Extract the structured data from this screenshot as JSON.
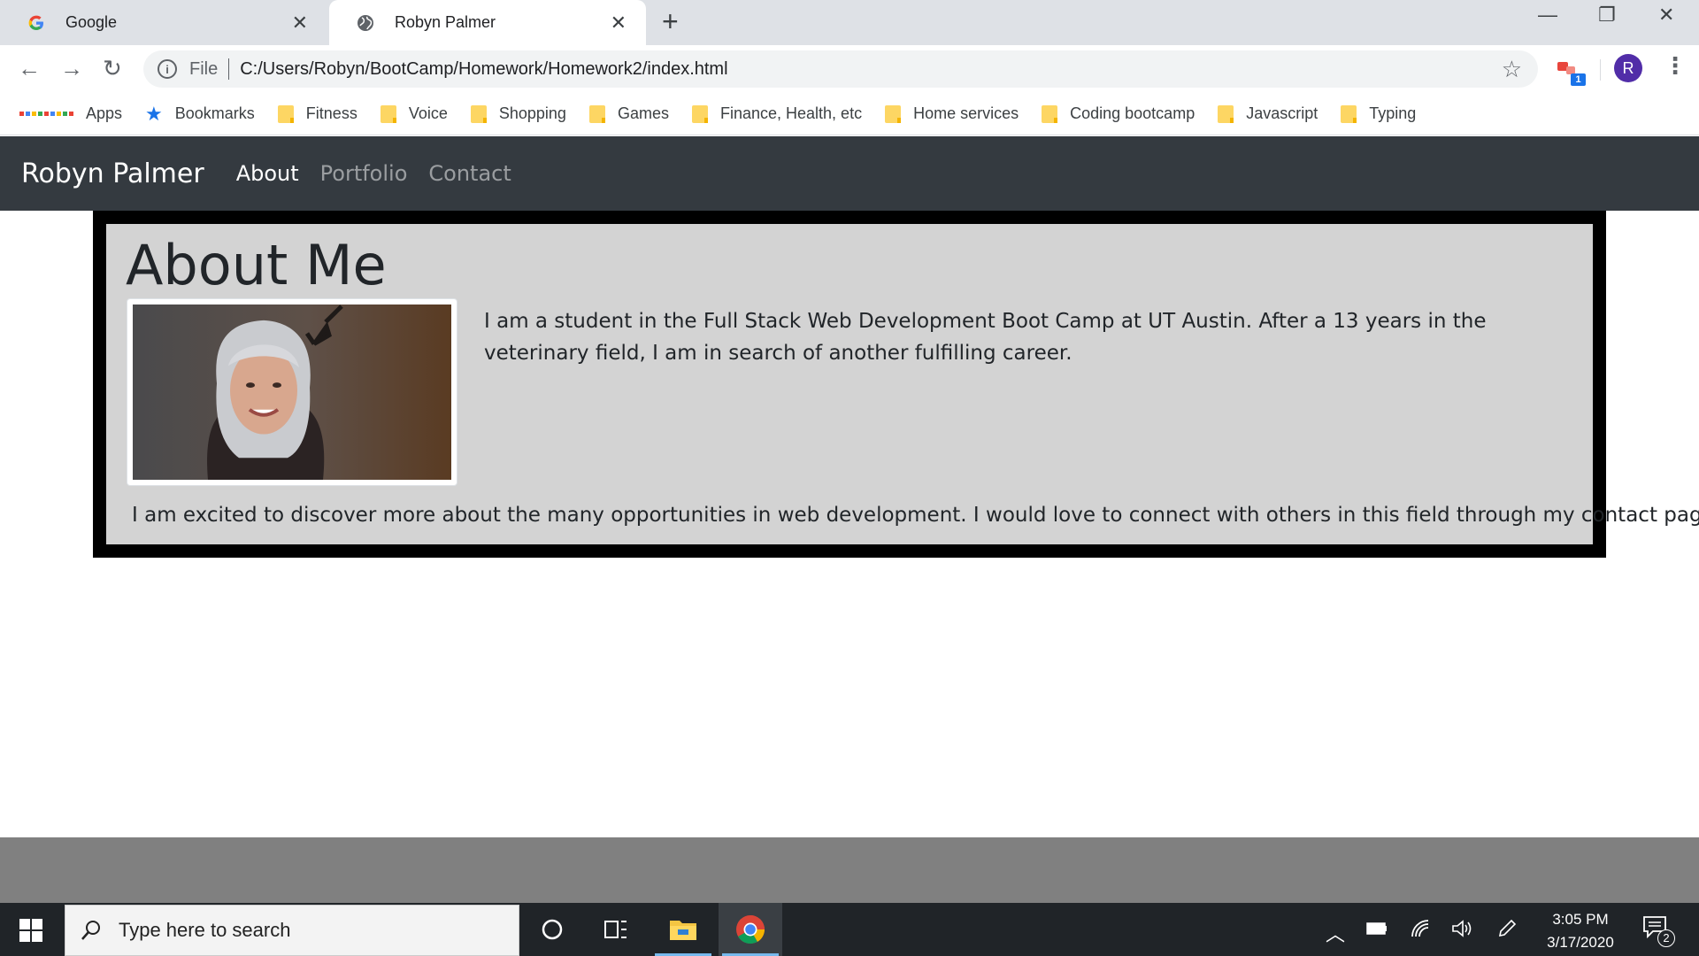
{
  "browser": {
    "tabs": [
      {
        "title": "Google",
        "icon": "google-icon",
        "active": false
      },
      {
        "title": "Robyn Palmer",
        "icon": "globe-icon",
        "active": true
      }
    ],
    "new_tab": "+",
    "address": {
      "scheme": "File",
      "url": "C:/Users/Robyn/BootCamp/Homework/Homework2/index.html"
    },
    "extension_badge": "1",
    "avatar_initial": "R",
    "bookmarks": [
      {
        "label": "Apps",
        "icon": "apps-grid-icon"
      },
      {
        "label": "Bookmarks",
        "icon": "star-icon"
      },
      {
        "label": "Fitness",
        "icon": "folder-icon"
      },
      {
        "label": "Voice",
        "icon": "folder-icon"
      },
      {
        "label": "Shopping",
        "icon": "folder-icon"
      },
      {
        "label": "Games",
        "icon": "folder-icon"
      },
      {
        "label": "Finance, Health, etc",
        "icon": "folder-icon"
      },
      {
        "label": "Home services",
        "icon": "folder-icon"
      },
      {
        "label": "Coding bootcamp",
        "icon": "folder-icon"
      },
      {
        "label": "Javascript",
        "icon": "folder-icon"
      },
      {
        "label": "Typing",
        "icon": "folder-icon"
      }
    ]
  },
  "site": {
    "brand": "Robyn Palmer",
    "nav": [
      {
        "label": "About",
        "active": true
      },
      {
        "label": "Portfolio",
        "active": false
      },
      {
        "label": "Contact",
        "active": false
      }
    ],
    "about": {
      "title": "About Me",
      "intro": "I am a student in the Full Stack Web Development Boot Camp at UT Austin. After a 13 years in the veterinary field, I am in search of another fulfilling career.",
      "outro": "I am excited to discover more about the many opportunities in web development. I would love to connect with others in this field through my contact page."
    }
  },
  "taskbar": {
    "search_placeholder": "Type here to search",
    "time": "3:05 PM",
    "date": "3/17/2020",
    "notification_count": "2"
  },
  "colors": {
    "navbar_bg": "#343a40",
    "about_bg": "#d3d3d3",
    "about_border": "#000000",
    "footer_band": "#808080",
    "taskbar_bg": "#202428",
    "avatar_bg": "#512da8"
  }
}
